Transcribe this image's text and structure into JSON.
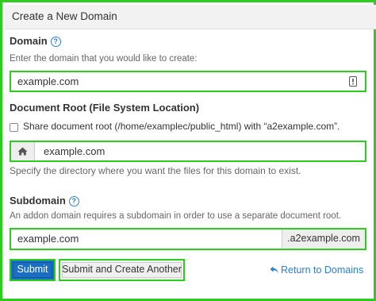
{
  "header": {
    "title": "Create a New Domain"
  },
  "domain": {
    "label": "Domain",
    "help_icon": "question-circle-icon",
    "hint": "Enter the domain that you would like to create:",
    "value": "example.com",
    "field_icon": "password-manager-icon"
  },
  "docroot": {
    "label": "Document Root (File System Location)",
    "share_checkbox_label": "Share document root (/home/examplec/public_html) with “a2example.com”.",
    "share_checked": false,
    "addon_icon": "home-icon",
    "value": "example.com",
    "hint": "Specify the directory where you want the files for this domain to exist."
  },
  "subdomain": {
    "label": "Subdomain",
    "help_icon": "question-circle-icon",
    "hint": "An addon domain requires a subdomain in order to use a separate document root.",
    "value": "example.com",
    "suffix": ".a2example.com"
  },
  "actions": {
    "submit_label": "Submit",
    "submit_another_label": "Submit and Create Another",
    "return_label": "Return to Domains",
    "return_icon": "return-arrow-icon"
  },
  "colors": {
    "highlight": "#2ecc1f",
    "primary": "#1a6fc4",
    "link": "#2a7fd4"
  }
}
